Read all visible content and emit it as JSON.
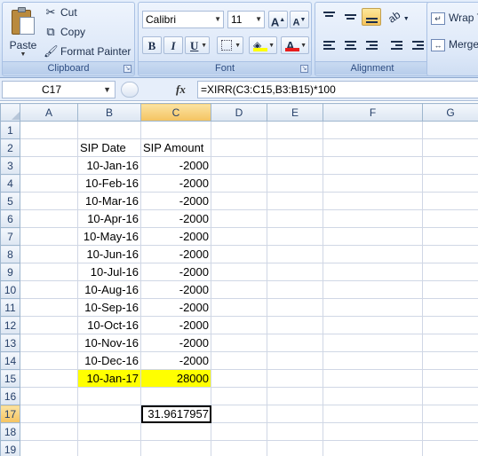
{
  "ribbon": {
    "clipboard": {
      "paste_label": "Paste",
      "cut_label": "Cut",
      "copy_label": "Copy",
      "format_painter_label": "Format Painter",
      "group_label": "Clipboard"
    },
    "font": {
      "name": "Calibri",
      "size": "11",
      "bold": "B",
      "italic": "I",
      "underline": "U",
      "font_color_glyph": "A",
      "grow_glyph": "A",
      "shrink_glyph": "A",
      "group_label": "Font",
      "fill_color": "#ffff00",
      "font_color": "#e81c1c"
    },
    "alignment": {
      "group_label": "Alignment",
      "orientation_glyph": "ab"
    },
    "wrap": {
      "wrap_label": "Wrap T",
      "merge_label": "Merge"
    }
  },
  "formula_bar": {
    "name_box": "C17",
    "fx": "fx",
    "formula": "=XIRR(C3:C15,B3:B15)*100"
  },
  "sheet": {
    "columns": [
      "A",
      "B",
      "C",
      "D",
      "E",
      "F",
      "G"
    ],
    "selected_column": "C",
    "selected_row": "17",
    "highlight_color": "#ffff00",
    "rows": [
      {
        "num": "1",
        "b": "",
        "c": ""
      },
      {
        "num": "2",
        "b": "SIP Date",
        "c": "SIP Amount"
      },
      {
        "num": "3",
        "b": "10-Jan-16",
        "c": "-2000"
      },
      {
        "num": "4",
        "b": "10-Feb-16",
        "c": "-2000"
      },
      {
        "num": "5",
        "b": "10-Mar-16",
        "c": "-2000"
      },
      {
        "num": "6",
        "b": "10-Apr-16",
        "c": "-2000"
      },
      {
        "num": "7",
        "b": "10-May-16",
        "c": "-2000"
      },
      {
        "num": "8",
        "b": "10-Jun-16",
        "c": "-2000"
      },
      {
        "num": "9",
        "b": "10-Jul-16",
        "c": "-2000"
      },
      {
        "num": "10",
        "b": "10-Aug-16",
        "c": "-2000"
      },
      {
        "num": "11",
        "b": "10-Sep-16",
        "c": "-2000"
      },
      {
        "num": "12",
        "b": "10-Oct-16",
        "c": "-2000"
      },
      {
        "num": "13",
        "b": "10-Nov-16",
        "c": "-2000"
      },
      {
        "num": "14",
        "b": "10-Dec-16",
        "c": "-2000"
      },
      {
        "num": "15",
        "b": "10-Jan-17",
        "c": "28000"
      },
      {
        "num": "16",
        "b": "",
        "c": ""
      },
      {
        "num": "17",
        "b": "",
        "c": "31.9617957"
      },
      {
        "num": "18",
        "b": "",
        "c": ""
      },
      {
        "num": "19",
        "b": "",
        "c": ""
      }
    ]
  }
}
